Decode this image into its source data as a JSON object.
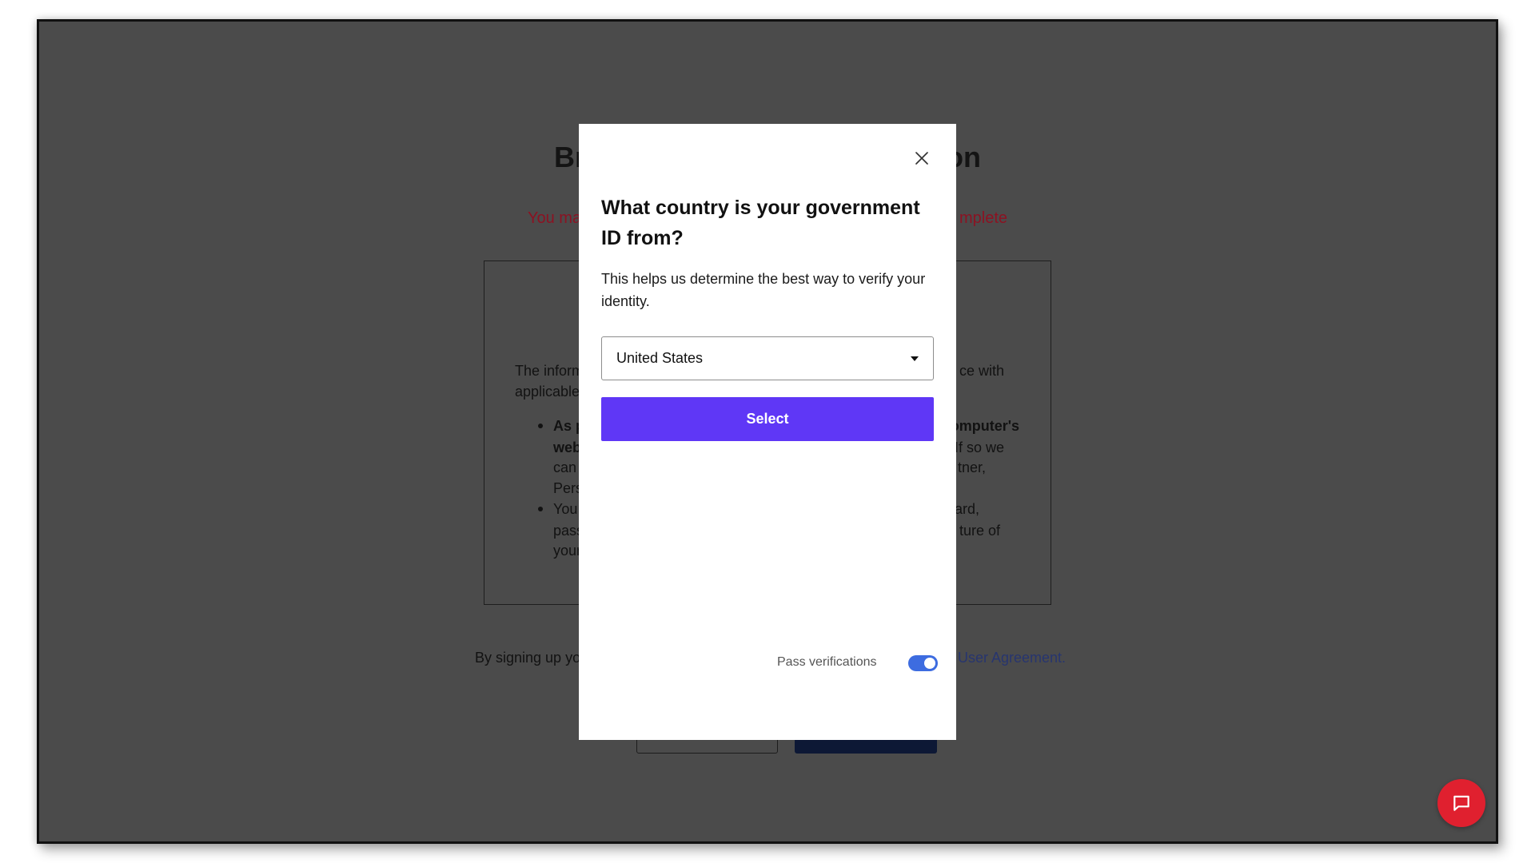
{
  "background_page": {
    "heading": {
      "left": "Br",
      "right": "on"
    },
    "warning": {
      "left": "You ma",
      "right": "mplete"
    },
    "info_box": {
      "intro": [
        {
          "left": "The inform",
          "right": "ce with"
        },
        {
          "left": "applicable"
        }
      ],
      "bullets": [
        {
          "lines": [
            {
              "left": "As p",
              "right": "omputer's"
            },
            {
              "left": "web",
              "right": "If so we"
            },
            {
              "left": "can",
              "right": "tner,"
            },
            {
              "left": "Pers"
            }
          ]
        },
        {
          "lines": [
            {
              "left": "You",
              "right": "ard,"
            },
            {
              "left": "pass",
              "right": "ture of"
            },
            {
              "left": "your"
            }
          ]
        }
      ]
    },
    "terms": {
      "left": "By signing up yo",
      "link": "User Agreement."
    }
  },
  "modal": {
    "title": "What country is your government ID from?",
    "description": "This helps us determine the best way to verify your identity.",
    "country_select": {
      "value": "United States"
    },
    "select_button_label": "Select",
    "pass_verifications": {
      "label": "Pass verifications",
      "enabled": true
    }
  },
  "icons": {
    "close": "close-icon",
    "dropdown": "caret-down-icon",
    "chat": "chat-icon"
  },
  "colors": {
    "backdrop": "#4b4b4b",
    "select_button": "#5f37f6",
    "toggle_on": "#3d6ce0",
    "chat_button": "#e0202f",
    "warning_text": "#8c1222",
    "link_text": "#27356f"
  }
}
